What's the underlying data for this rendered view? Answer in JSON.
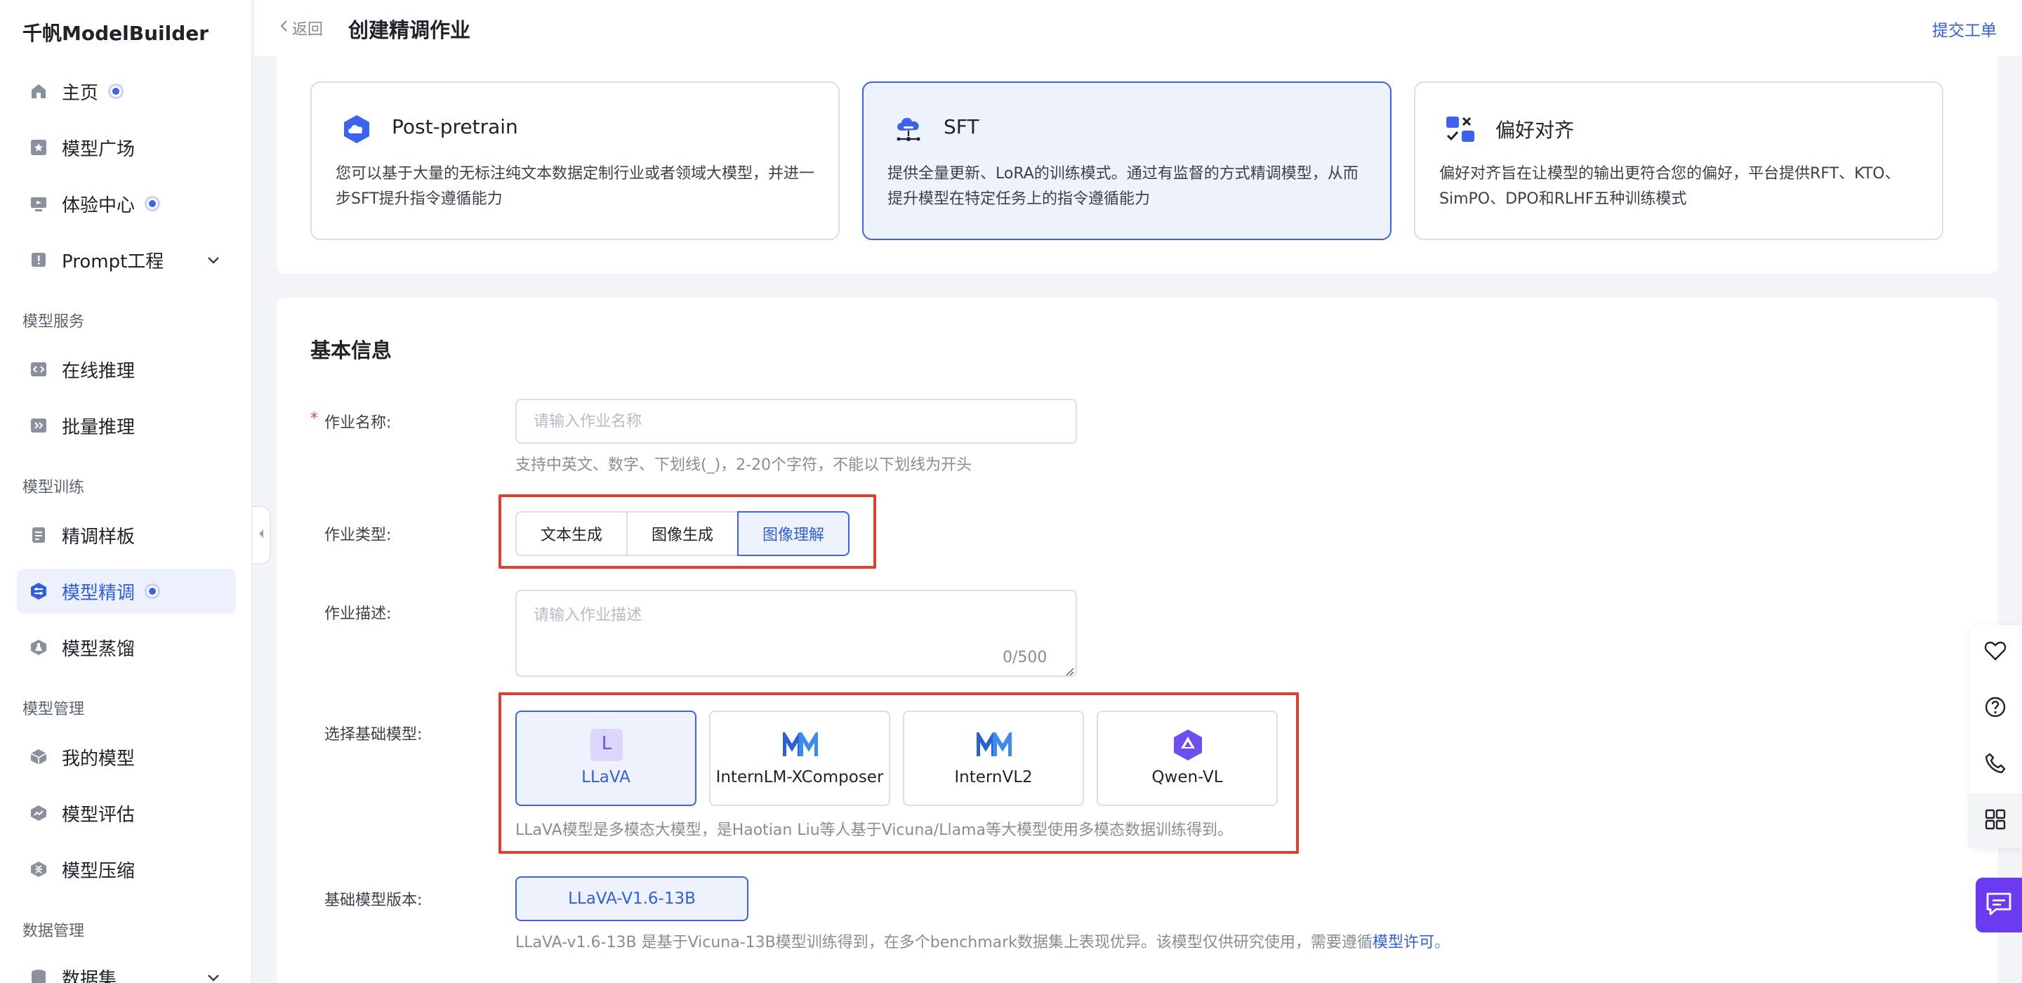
{
  "app": {
    "name": "千帆ModelBuilder"
  },
  "sidebar": {
    "items": [
      {
        "label": "主页"
      },
      {
        "label": "模型广场"
      },
      {
        "label": "体验中心"
      },
      {
        "label": "Prompt工程"
      },
      {
        "label": "在线推理"
      },
      {
        "label": "批量推理"
      },
      {
        "label": "精调样板"
      },
      {
        "label": "模型精调"
      },
      {
        "label": "模型蒸馏"
      },
      {
        "label": "我的模型"
      },
      {
        "label": "模型评估"
      },
      {
        "label": "模型压缩"
      },
      {
        "label": "数据集"
      }
    ],
    "sections": [
      "模型服务",
      "模型训练",
      "模型管理",
      "数据管理"
    ],
    "active_item": "模型精调"
  },
  "header": {
    "back_label": "返回",
    "title": "创建精调作业",
    "ticket_link": "提交工单"
  },
  "training_types": [
    {
      "title": "Post-pretrain",
      "desc": "您可以基于大量的无标注纯文本数据定制行业或者领域大模型，并进一步SFT提升指令遵循能力",
      "icon": "cloud-hexagon-icon",
      "selected": false
    },
    {
      "title": "SFT",
      "desc": "提供全量更新、LoRA的训练模式。通过有监督的方式精调模型，从而提升模型在特定任务上的指令遵循能力",
      "icon": "cloud-network-icon",
      "selected": true
    },
    {
      "title": "偏好对齐",
      "desc": "偏好对齐旨在让模型的输出更符合您的偏好，平台提供RFT、KTO、SimPO、DPO和RLHF五种训练模式",
      "icon": "check-cross-icon",
      "selected": false
    }
  ],
  "form": {
    "section_title": "基本信息",
    "job_name": {
      "label": "作业名称:",
      "required_mark": "*",
      "placeholder": "请输入作业名称",
      "value": "",
      "hint": "支持中英文、数字、下划线(_)，2-20个字符，不能以下划线为开头"
    },
    "job_type": {
      "label": "作业类型:",
      "options": [
        "文本生成",
        "图像生成",
        "图像理解"
      ],
      "selected": "图像理解"
    },
    "job_desc": {
      "label": "作业描述:",
      "placeholder": "请输入作业描述",
      "value": "",
      "counter": "0/500"
    },
    "base_model": {
      "label": "选择基础模型:",
      "options": [
        {
          "name": "LLaVA",
          "icon": "llava-letter-icon",
          "icon_letter": "L"
        },
        {
          "name": "InternLM-XComposer",
          "icon": "internlm-logo-icon"
        },
        {
          "name": "InternVL2",
          "icon": "internvl-logo-icon"
        },
        {
          "name": "Qwen-VL",
          "icon": "qwen-logo-icon"
        }
      ],
      "selected": "LLaVA",
      "hint": "LLaVA模型是多模态大模型，是Haotian Liu等人基于Vicuna/Llama等大模型使用多模态数据训练得到。"
    },
    "base_version": {
      "label": "基础模型版本:",
      "value": "LLaVA-V1.6-13B",
      "hint_prefix": "LLaVA-v1.6-13B 是基于Vicuna-13B模型训练得到，在多个benchmark数据集上表现优异。该模型仅供研究使用，需要遵循",
      "hint_link": "模型许可",
      "hint_suffix": "。"
    }
  },
  "float_toolbar": [
    "heart-icon",
    "help-circle-icon",
    "phone-icon",
    "apps-grid-icon"
  ],
  "chat_button": "chat-bubble-icon",
  "colors": {
    "accent": "#3b63f0",
    "accent_bg": "#eef2fd",
    "highlight_box": "#e0402f",
    "chat_purple": "#6b3bf2"
  }
}
